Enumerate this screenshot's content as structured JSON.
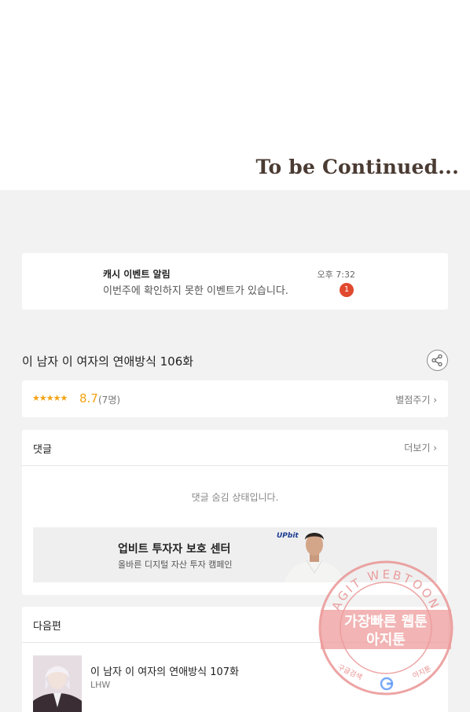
{
  "banner": {
    "to_be_continued": "To be Continued..."
  },
  "notification": {
    "title": "캐시 이벤트 알림",
    "message": "이번주에 확인하지 못한 이벤트가 있습니다.",
    "time": "오후 7:32",
    "badge": "1",
    "badge_color": "#e0492e"
  },
  "episode": {
    "title": "이 남자 이 여자의 연애방식 106화",
    "share_icon": "share-icon"
  },
  "rating": {
    "stars": "★★★★★",
    "score": "8.7",
    "count": "(7명)",
    "rate_link": "별점주기 ›",
    "star_color": "#f3a212"
  },
  "comments": {
    "label": "댓글",
    "more": "더보기 ›",
    "hidden_message": "댓글 숨김 상태입니다."
  },
  "ad": {
    "title": "업비트 투자자 보호 센터",
    "subtitle": "올바른 디지털 자산 투자 캠페인",
    "logo": "UPbit"
  },
  "next": {
    "label": "다음편",
    "title": "이 남자 이 여자의 연애방식 107화",
    "author": "LHW"
  },
  "watermark": {
    "arc_text": "AGIT WEBTOON",
    "line1": "가장빠른 웹툰",
    "line2": "아지툰",
    "bottom_left": "구글검색",
    "bottom_right": "아지툰",
    "center_icon": "google-g-icon"
  }
}
